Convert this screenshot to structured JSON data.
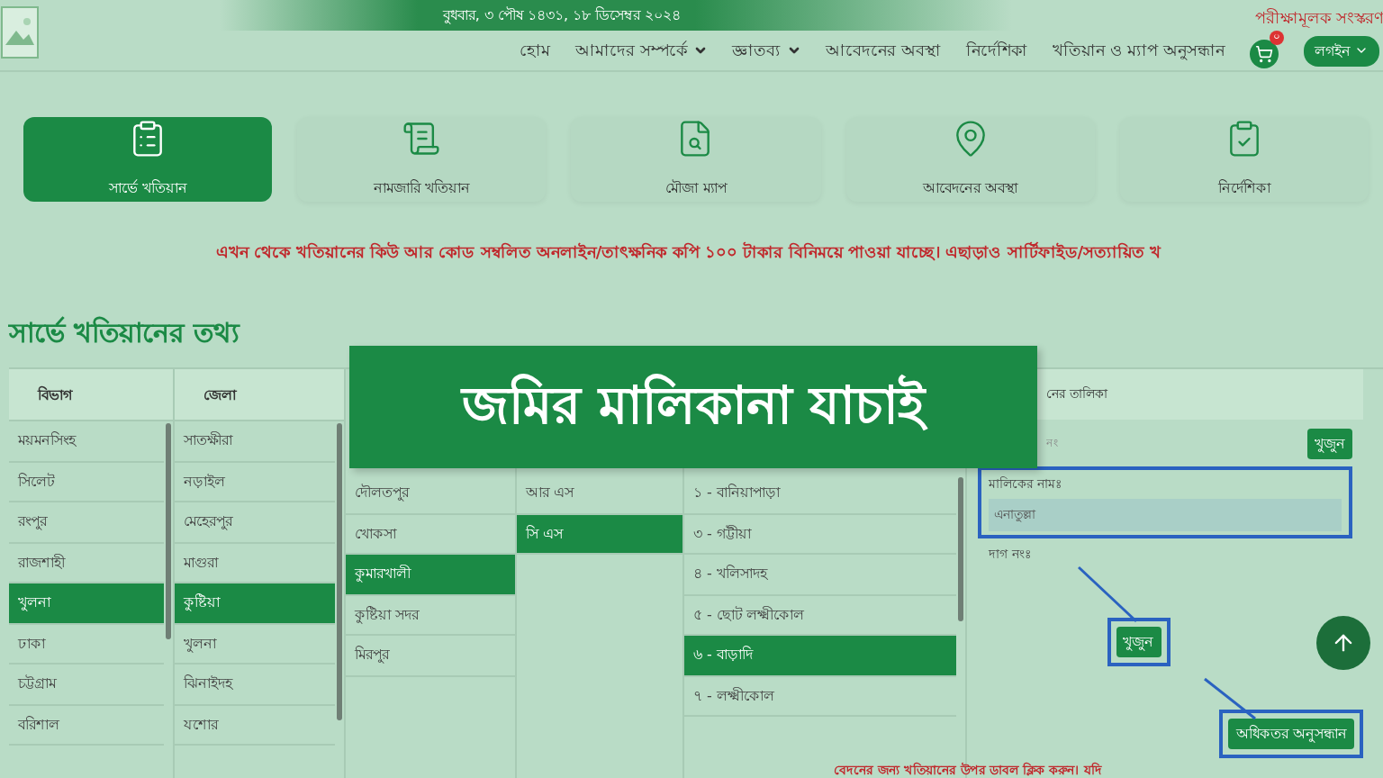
{
  "header": {
    "date": "বুধবার, ৩ পৌষ ১৪৩১, ১৮ ডিসেম্বর ২০২৪",
    "notice": "পরীক্ষামূলক সংস্করণ",
    "nav": [
      {
        "label": "হোম",
        "dropdown": false
      },
      {
        "label": "আমাদের সম্পর্কে",
        "dropdown": true
      },
      {
        "label": "জ্ঞাতব্য",
        "dropdown": true
      },
      {
        "label": "আবেদনের অবস্থা",
        "dropdown": false
      },
      {
        "label": "নির্দেশিকা",
        "dropdown": false
      },
      {
        "label": "খতিয়ান ও ম্যাপ অনুসন্ধান",
        "dropdown": false
      }
    ],
    "cart_count": "০",
    "login": "লগইন"
  },
  "tiles": [
    {
      "label": "সার্ভে খতিয়ান",
      "selected": true,
      "kind": "clipboard"
    },
    {
      "label": "নামজারি খতিয়ান",
      "selected": false,
      "kind": "scroll"
    },
    {
      "label": "মৌজা ম্যাপ",
      "selected": false,
      "kind": "map"
    },
    {
      "label": "আবেদনের অবস্থা",
      "selected": false,
      "kind": "location"
    },
    {
      "label": "নির্দেশিকা",
      "selected": false,
      "kind": "checklist"
    }
  ],
  "marquee": "এখন থেকে খতিয়ানের কিউ আর কোড সম্বলিত অনলাইন/তাৎক্ষনিক কপি ১০০ টাকার বিনিময়ে পাওয়া যাচ্ছে। এছাড়াও সার্টিফাইড/সত্যায়িত খ",
  "section_title": "সার্ভে খতিয়ানের তথ্য",
  "columns": [
    {
      "heading": "বিভাগ",
      "items": [
        {
          "label": "ময়মনসিংহ",
          "selected": false
        },
        {
          "label": "সিলেট",
          "selected": false
        },
        {
          "label": "রংপুর",
          "selected": false
        },
        {
          "label": "রাজশাহী",
          "selected": false
        },
        {
          "label": "খুলনা",
          "selected": true
        },
        {
          "label": "ঢাকা",
          "selected": false
        },
        {
          "label": "চট্টগ্রাম",
          "selected": false
        },
        {
          "label": "বরিশাল",
          "selected": false
        }
      ]
    },
    {
      "heading": "জেলা",
      "items": [
        {
          "label": "সাতক্ষীরা",
          "selected": false
        },
        {
          "label": "নড়াইল",
          "selected": false
        },
        {
          "label": "মেহেরপুর",
          "selected": false
        },
        {
          "label": "মাগুরা",
          "selected": false
        },
        {
          "label": "কুষ্টিয়া",
          "selected": true
        },
        {
          "label": "খুলনা",
          "selected": false
        },
        {
          "label": "ঝিনাইদহ",
          "selected": false
        },
        {
          "label": "যশোর",
          "selected": false
        }
      ]
    },
    {
      "items": [
        {
          "label": "দৌলতপুর",
          "selected": false
        },
        {
          "label": "খোকসা",
          "selected": false
        },
        {
          "label": "কুমারখালী",
          "selected": true
        },
        {
          "label": "কুষ্টিয়া সদর",
          "selected": false
        },
        {
          "label": "মিরপুর",
          "selected": false
        }
      ]
    },
    {
      "items": [
        {
          "label": "আর এস",
          "selected": false
        },
        {
          "label": "সি এস",
          "selected": true
        }
      ]
    },
    {
      "items": [
        {
          "label": "১ - বানিয়াপাড়া",
          "selected": false
        },
        {
          "label": "৩ - গট্টীয়া",
          "selected": false
        },
        {
          "label": "৪ - খলিসাদহ",
          "selected": false
        },
        {
          "label": "৫ - ছোট লক্ষ্মীকোল",
          "selected": false
        },
        {
          "label": "৬ - বাড়াদি",
          "selected": true
        },
        {
          "label": "৭ - লক্ষ্মীকোল",
          "selected": false
        }
      ]
    }
  ],
  "khatian_panel": {
    "heading": "নের তালিকা",
    "search_placeholder": "নং",
    "search_button": "খুজুন",
    "owner_label": "মালিকের নামঃ",
    "owner_value": "এনাতুল্লা",
    "dag_label": "দাগ নংঃ",
    "find_button": "খুজুন",
    "advanced_button": "অধিকতর অনুসন্ধান",
    "note": "বেদনের জন্য খতিয়ানের উপর ডাবল ক্লিক করুন। যদি"
  },
  "banner": "জমির মালিকানা যাচাই"
}
